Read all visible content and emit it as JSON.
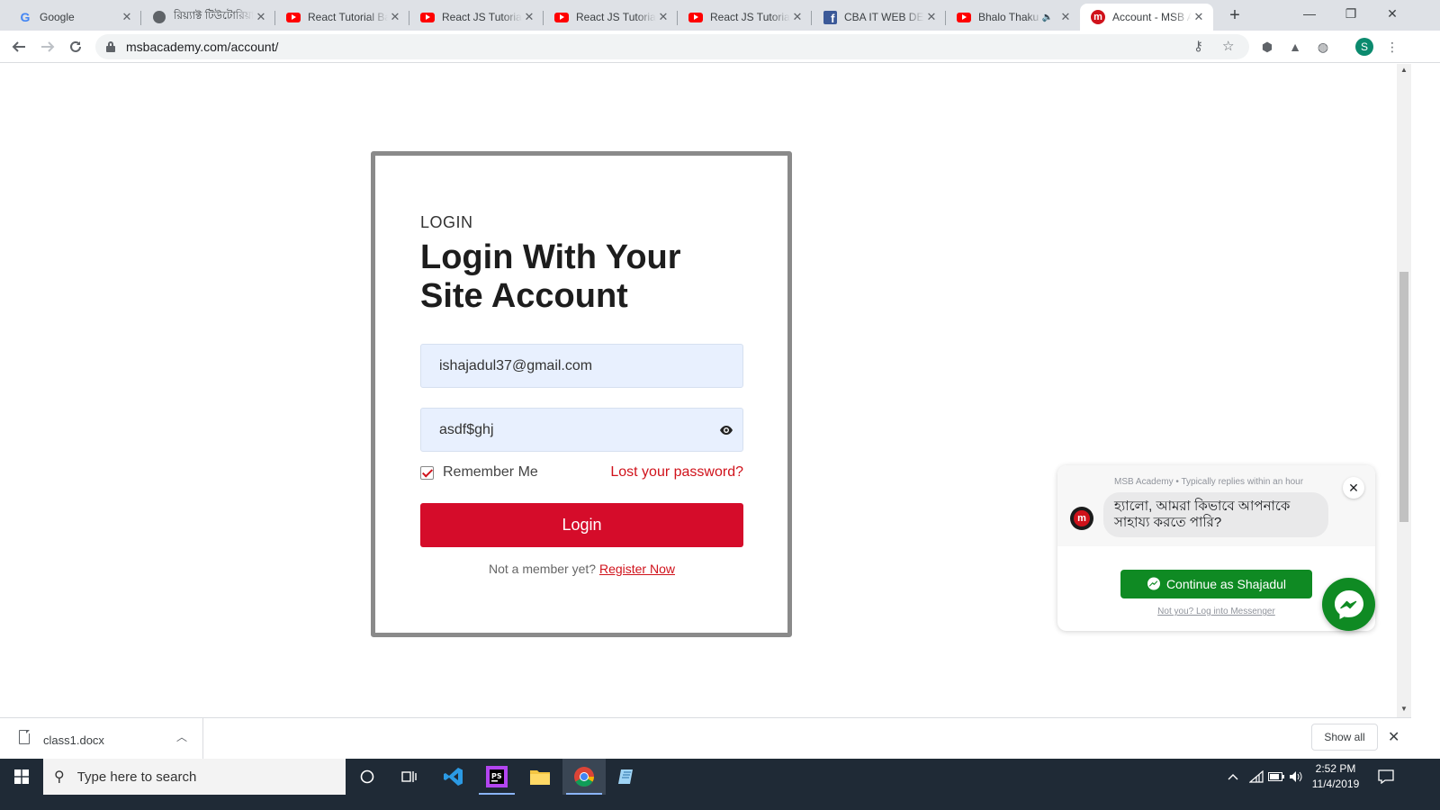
{
  "browser": {
    "tabs": [
      {
        "title": "Google",
        "favicon": "google-icon"
      },
      {
        "title": "রিয়্যাক্ট টিউটোরিয়াল",
        "favicon": "globe-icon"
      },
      {
        "title": "React Tutorial Ba",
        "favicon": "youtube-icon"
      },
      {
        "title": "React JS Tutorial",
        "favicon": "youtube-icon"
      },
      {
        "title": "React JS Tutorial",
        "favicon": "youtube-icon"
      },
      {
        "title": "React JS Tutorial",
        "favicon": "youtube-icon"
      },
      {
        "title": "CBA IT WEB DEV",
        "favicon": "facebook-icon"
      },
      {
        "title": "Bhalo Thaku",
        "favicon": "youtube-icon"
      },
      {
        "title": "Account - MSB A",
        "favicon": "msb-icon"
      }
    ],
    "url": "msbacademy.com/account/",
    "profile_initial": "S"
  },
  "login": {
    "eyebrow": "LOGIN",
    "heading": "Login With Your Site Account",
    "email_value": "ishajadul37@gmail.com",
    "password_value": "asdf$ghj",
    "remember_label": "Remember Me",
    "remember_checked": true,
    "lost_password": "Lost your password?",
    "login_button": "Login",
    "register_prompt": "Not a member yet?",
    "register_link": "Register Now"
  },
  "messenger": {
    "page_meta": "MSB Academy • Typically replies within an hour",
    "greeting": "হ্যালো, আমরা কিভাবে আপনাকে সাহায্য করতে পারি?",
    "continue_button": "Continue as Shajadul",
    "not_you": "Not you? Log into Messenger"
  },
  "download_bar": {
    "file_name": "class1.docx",
    "show_all": "Show all"
  },
  "taskbar": {
    "search_placeholder": "Type here to search",
    "time": "2:52 PM",
    "date": "11/4/2019"
  },
  "colors": {
    "brand_red": "#d50c2a",
    "messenger_green": "#0f8a23",
    "field_bg": "#e8f0fe",
    "taskbar": "#1f2a36"
  }
}
